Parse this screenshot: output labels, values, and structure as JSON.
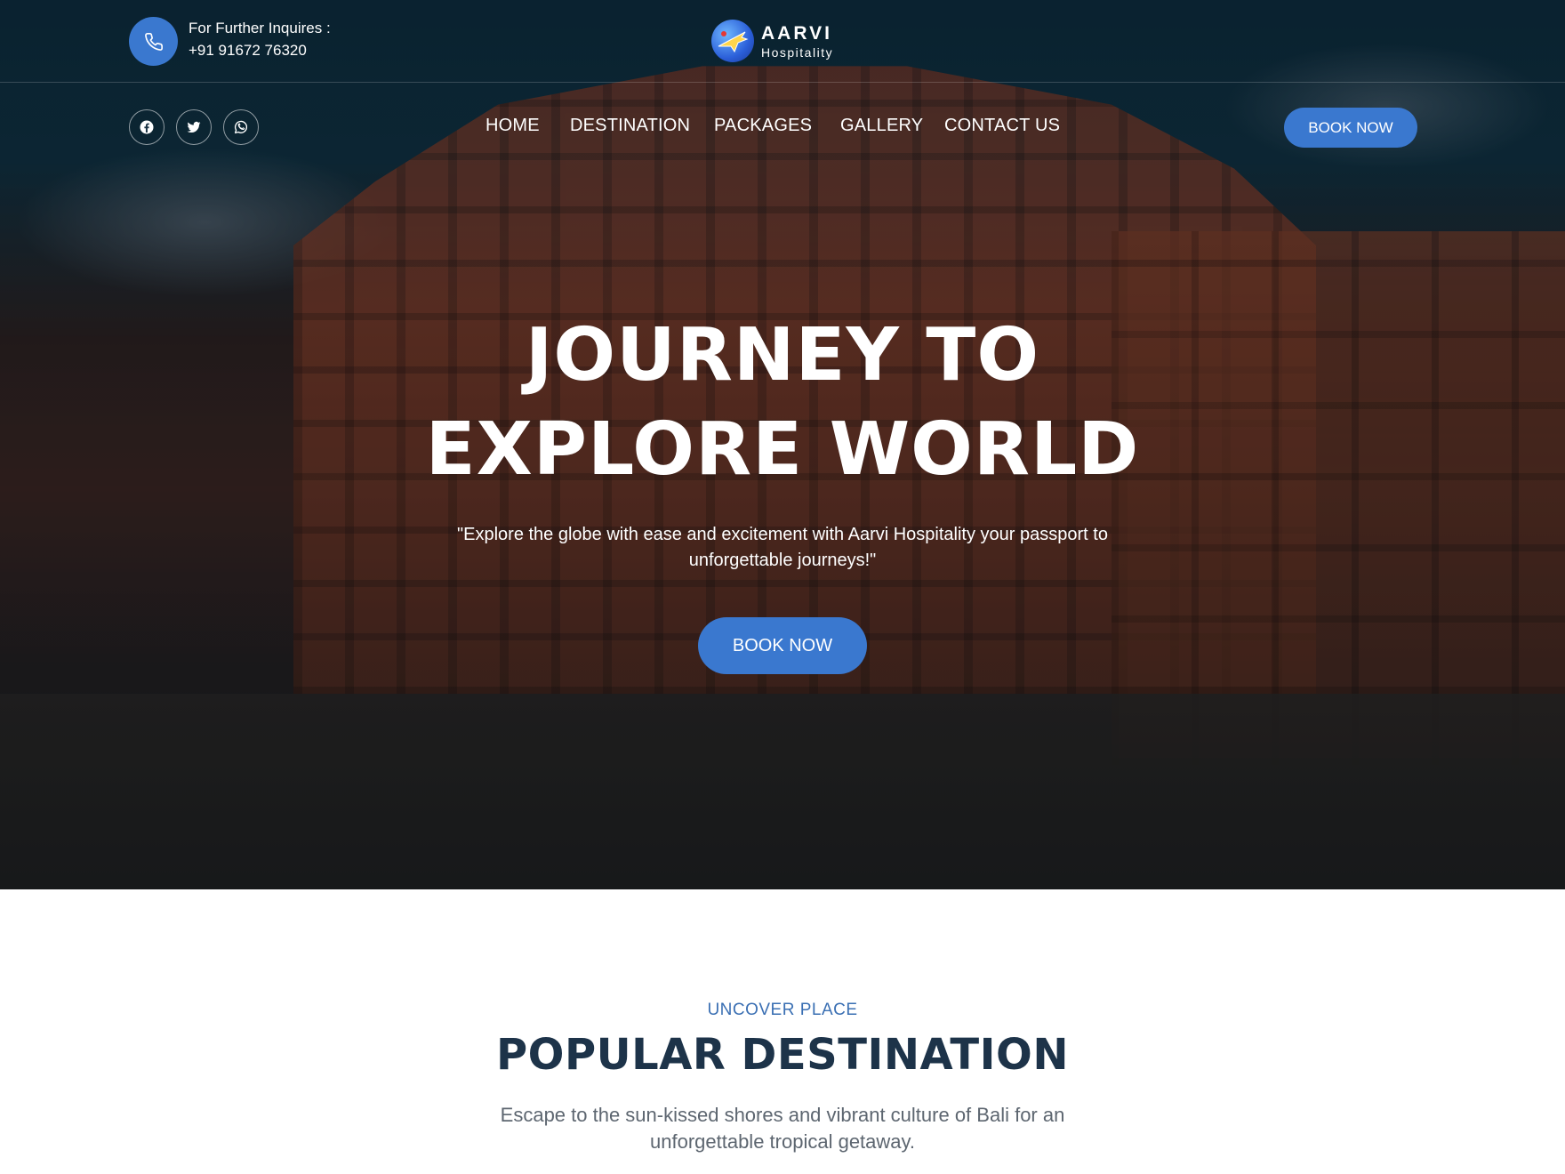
{
  "header": {
    "inquire_label": "For Further Inquires :",
    "phone": "+91 91672 76320",
    "logo": {
      "name": "AARVI",
      "sub": "Hospitality"
    }
  },
  "social": [
    {
      "name": "facebook",
      "icon": "facebook-icon"
    },
    {
      "name": "twitter",
      "icon": "twitter-icon"
    },
    {
      "name": "whatsapp",
      "icon": "whatsapp-icon"
    }
  ],
  "nav": {
    "items": [
      "HOME",
      "DESTINATION",
      "PACKAGES",
      "GALLERY",
      "CONTACT US"
    ],
    "book_now": "BOOK NOW"
  },
  "hero": {
    "title_line1": "JOURNEY TO",
    "title_line2": "EXPLORE WORLD",
    "subtitle_line1": "\"Explore the globe with ease and excitement with Aarvi Hospitality your passport to",
    "subtitle_line2": "unforgettable journeys!\"",
    "book_now": "BOOK NOW"
  },
  "section": {
    "eyebrow": "UNCOVER PLACE",
    "title": "POPULAR DESTINATION",
    "desc_line1": "Escape to the sun-kissed shores and vibrant culture of Bali for an",
    "desc_line2": "unforgettable tropical getaway."
  },
  "colors": {
    "accent": "#3a78cf",
    "heading": "#1d3349",
    "eyebrow": "#3a6fb3"
  }
}
